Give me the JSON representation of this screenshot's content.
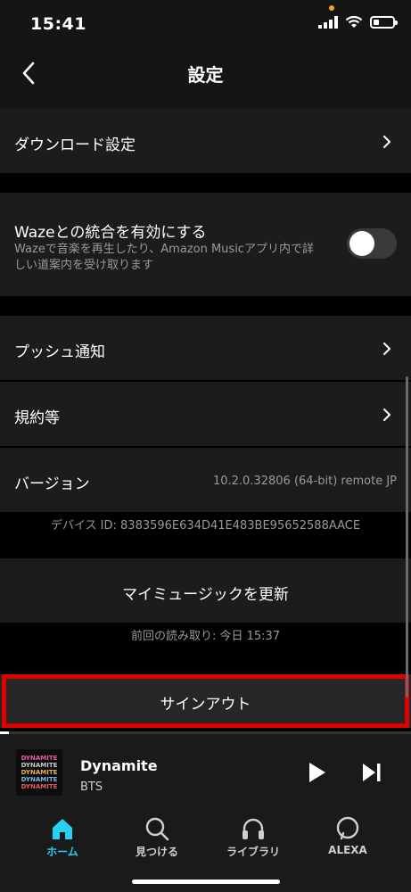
{
  "status_bar": {
    "time": "15:41"
  },
  "header": {
    "title": "設定"
  },
  "settings": {
    "download": {
      "label": "ダウンロード設定"
    },
    "waze": {
      "label": "Wazeとの統合を有効にする",
      "description_line1": "Wazeで音楽を再生したり、Amazon Musicアプリ内で詳",
      "description_line2": "しい道案内を受け取ります",
      "enabled": false
    },
    "push": {
      "label": "プッシュ通知"
    },
    "terms": {
      "label": "規約等"
    },
    "version": {
      "label": "バージョン",
      "value": "10.2.0.32806 (64-bit) remote JP"
    },
    "device_id": "デバイス ID: 8383596E634D41E483BE95652588AACE",
    "refresh": {
      "label": "マイミュージックを更新",
      "last_read": "前回の読み取り: 今日 15:37"
    },
    "signout": {
      "label": "サインアウト"
    }
  },
  "player": {
    "title": "Dynamite",
    "artist": "BTS",
    "art_text": "DYNAMITE"
  },
  "tabs": [
    {
      "label": "ホーム"
    },
    {
      "label": "見つける"
    },
    {
      "label": "ライブラリ"
    },
    {
      "label": "ALEXA"
    }
  ],
  "colors": {
    "accent": "#25d1f2",
    "highlight": "#e00000"
  }
}
